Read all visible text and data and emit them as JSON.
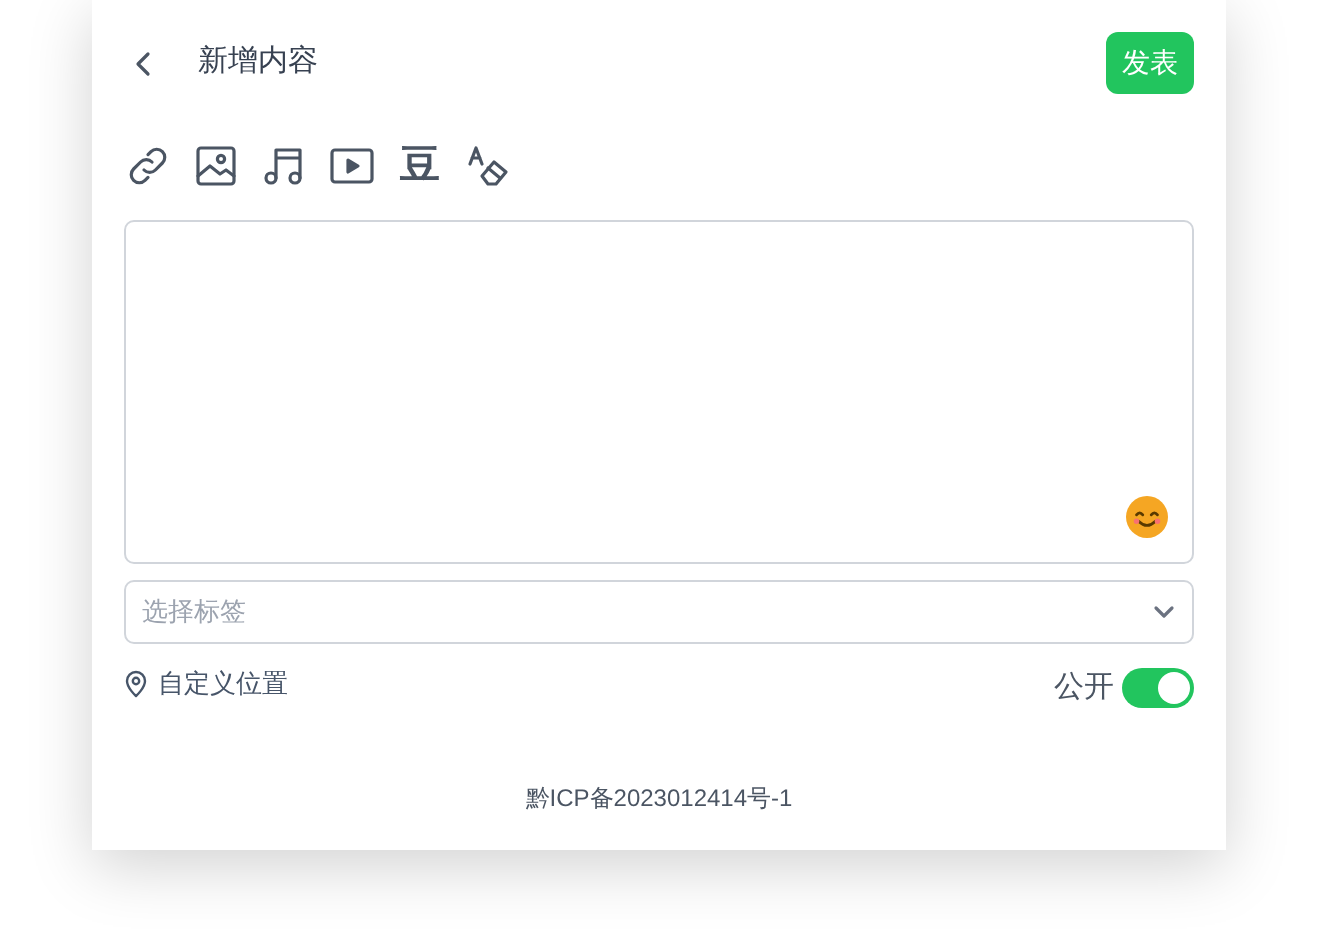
{
  "header": {
    "title": "新增内容",
    "submit": "发表"
  },
  "toolbar": [
    {
      "kind": "link"
    },
    {
      "kind": "image"
    },
    {
      "kind": "music"
    },
    {
      "kind": "video"
    },
    {
      "kind": "glyph",
      "label": "豆"
    },
    {
      "kind": "clear"
    }
  ],
  "tag_select": {
    "placeholder": "选择标签"
  },
  "location": {
    "label": "自定义位置"
  },
  "visibility": {
    "label": "公开",
    "on": true
  },
  "footer": {
    "icp": "黔ICP备2023012414号-1"
  }
}
